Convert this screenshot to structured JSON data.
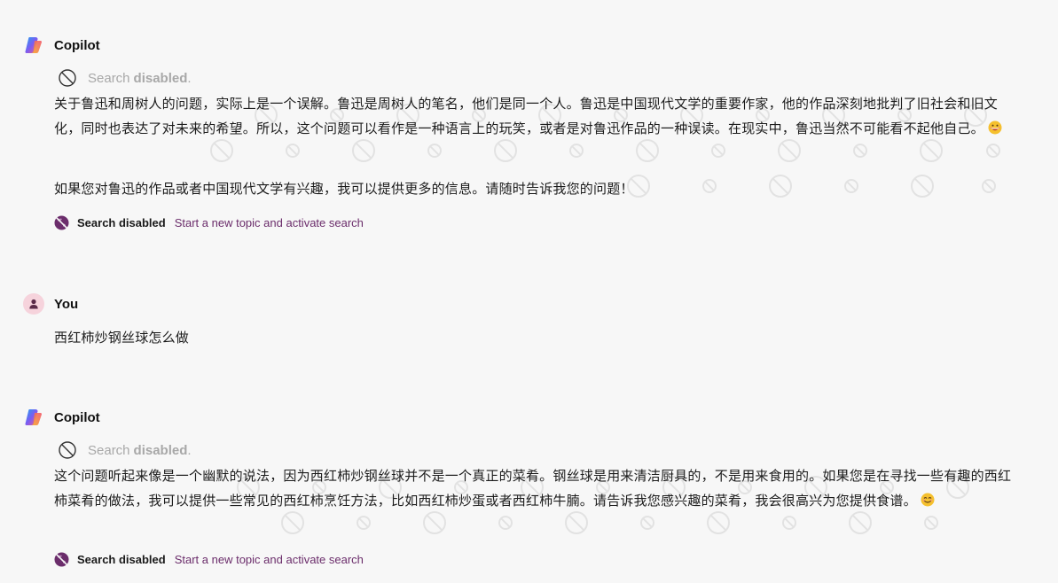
{
  "conversation": [
    {
      "author": "Copilot",
      "search_prefix": "Search",
      "search_state": "disabled",
      "search_suffix": ".",
      "paragraphs": [
        "关于鲁迅和周树人的问题，实际上是一个误解。鲁迅是周树人的笔名，他们是同一个人。鲁迅是中国现代文学的重要作家，他的作品深刻地批判了旧社会和旧文化，同时也表达了对未来的希望。所以，这个问题可以看作是一种语言上的玩笑，或者是对鲁迅作品的一种误读。在现实中，鲁迅当然不可能看不起他自己。",
        "如果您对鲁迅的作品或者中国现代文学有兴趣，我可以提供更多的信息。请随时告诉我您的问题！"
      ],
      "footer_label": "Search disabled",
      "footer_link": "Start a new topic and activate search"
    },
    {
      "author": "You",
      "text": "西红柿炒钢丝球怎么做"
    },
    {
      "author": "Copilot",
      "search_prefix": "Search",
      "search_state": "disabled",
      "search_suffix": ".",
      "paragraphs": [
        "这个问题听起来像是一个幽默的说法，因为西红柿炒钢丝球并不是一个真正的菜肴。钢丝球是用来清洁厨具的，不是用来食用的。如果您是在寻找一些有趣的西红柿菜肴的做法，我可以提供一些常见的西红柿烹饪方法，比如西红柿炒蛋或者西红柿牛腩。请告诉我您感兴趣的菜肴，我会很高兴为您提供食谱。"
      ],
      "footer_label": "Search disabled",
      "footer_link": "Start a new topic and activate search"
    }
  ],
  "icons": {
    "copilot_avatar": "copilot-logo-icon",
    "user_avatar": "user-icon",
    "search_disabled": "ban-icon",
    "footer_search": "globe-disabled-icon",
    "emoji_1": "grinning-face-icon",
    "emoji_2": "smiling-face-icon"
  },
  "colors": {
    "background": "#f7f7f7",
    "link": "#6b2d6b",
    "user_avatar_bg": "#f6d3dc",
    "muted_text": "#a8a8a8"
  }
}
